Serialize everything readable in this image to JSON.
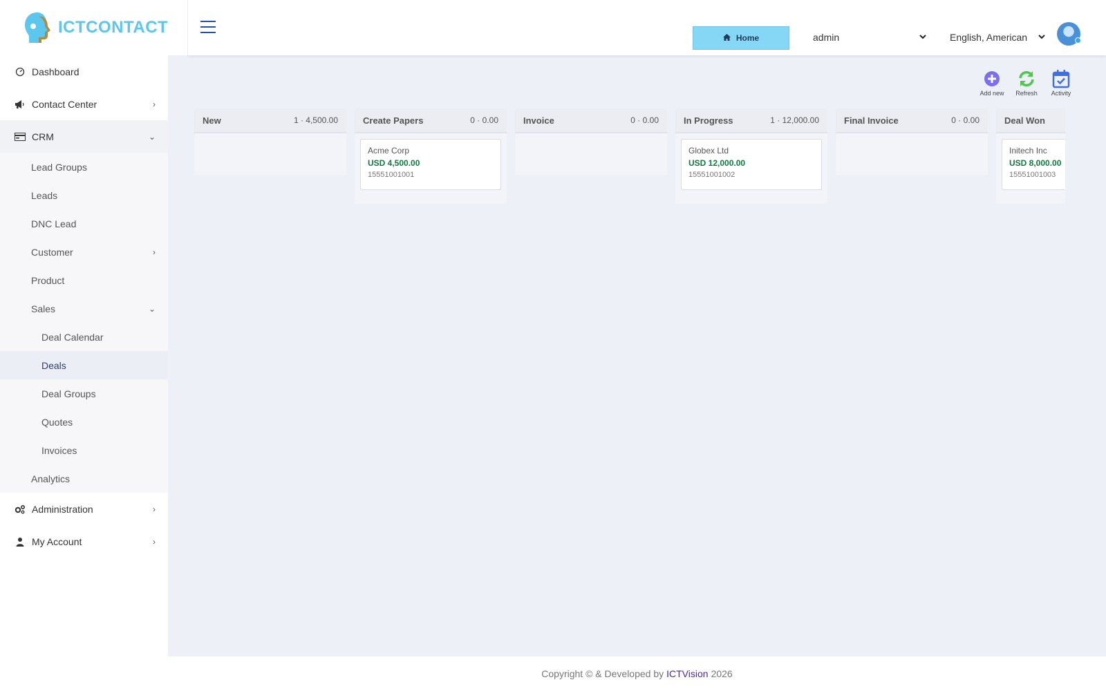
{
  "brand": {
    "logo_text": "ICTCONTACT"
  },
  "header": {
    "home_label": "Home",
    "user_select_value": "admin",
    "language_select_value": "English, American"
  },
  "sidebar": {
    "dashboard": "Dashboard",
    "contact_center": "Contact Center",
    "crm": "CRM",
    "crm_items": {
      "lead_groups": "Lead Groups",
      "leads": "Leads",
      "dnc_lead": "DNC Lead",
      "customer": "Customer",
      "product": "Product",
      "sales": "Sales",
      "sales_items": {
        "deal_calendar": "Deal Calendar",
        "deals": "Deals",
        "deal_groups": "Deal Groups",
        "quotes": "Quotes",
        "invoices": "Invoices"
      },
      "analytics": "Analytics"
    },
    "administration": "Administration",
    "my_account": "My Account"
  },
  "toolbar": {
    "add_new": "Add new",
    "refresh": "Refresh",
    "activity": "Activity"
  },
  "columns": [
    {
      "title": "New",
      "stats": "1 · 4,500.00"
    },
    {
      "title": "Create Papers",
      "stats": "0 · 0.00",
      "card": {
        "company": "Acme Corp",
        "amount": "USD 4,500.00",
        "phone": "15551001001"
      }
    },
    {
      "title": "Invoice",
      "stats": "0 · 0.00"
    },
    {
      "title": "In Progress",
      "stats": "1 · 12,000.00",
      "card": {
        "company": "Globex Ltd",
        "amount": "USD 12,000.00",
        "phone": "15551001002"
      }
    },
    {
      "title": "Final Invoice",
      "stats": "0 · 0.00"
    },
    {
      "title": "Deal Won",
      "stats": "",
      "card": {
        "company": "Initech Inc",
        "amount": "USD 8,000.00",
        "phone": "15551001003"
      }
    }
  ],
  "footer": {
    "prefix": "Copyright © & Developed by",
    "brand": "ICTVision",
    "year": "2026"
  },
  "colors": {
    "accent_blue": "#1e4fb3",
    "home_button": "#86d7f5",
    "amount_green": "#0f7a3e",
    "brand_cyan": "#5bc6ee",
    "footer_brand": "#4b2aa5"
  }
}
